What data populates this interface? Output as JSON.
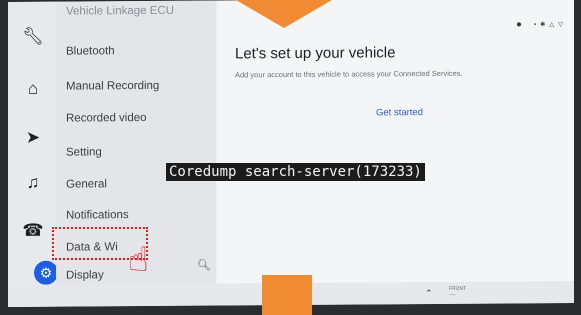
{
  "sidebar": {
    "items": [
      {
        "label": "Vehicle Linkage ECU"
      },
      {
        "label": "Bluetooth"
      },
      {
        "label": "Manual Recording"
      },
      {
        "label": "Recorded video"
      },
      {
        "label": "Setting"
      },
      {
        "label": "General"
      },
      {
        "label": "Notifications"
      },
      {
        "label": "Data & Wi"
      },
      {
        "label": "Display"
      }
    ]
  },
  "rail_icons": [
    "wrench-icon",
    "home-icon",
    "navigation-icon",
    "music-icon",
    "phone-icon",
    "gear-icon"
  ],
  "main": {
    "title": "Let's set up your vehicle",
    "subtitle": "Add your account to this vehicle to access your Connected Services.",
    "cta": "Get started"
  },
  "overlay": {
    "coredump": "Coredump search-server(173233)"
  },
  "bottom": {
    "front_label": "FRONT",
    "front_value": "----"
  },
  "colors": {
    "accent": "#1f5fe8",
    "link": "#2b5fc4",
    "annotation": "#e21d1d",
    "arrow": "#f08b33"
  }
}
